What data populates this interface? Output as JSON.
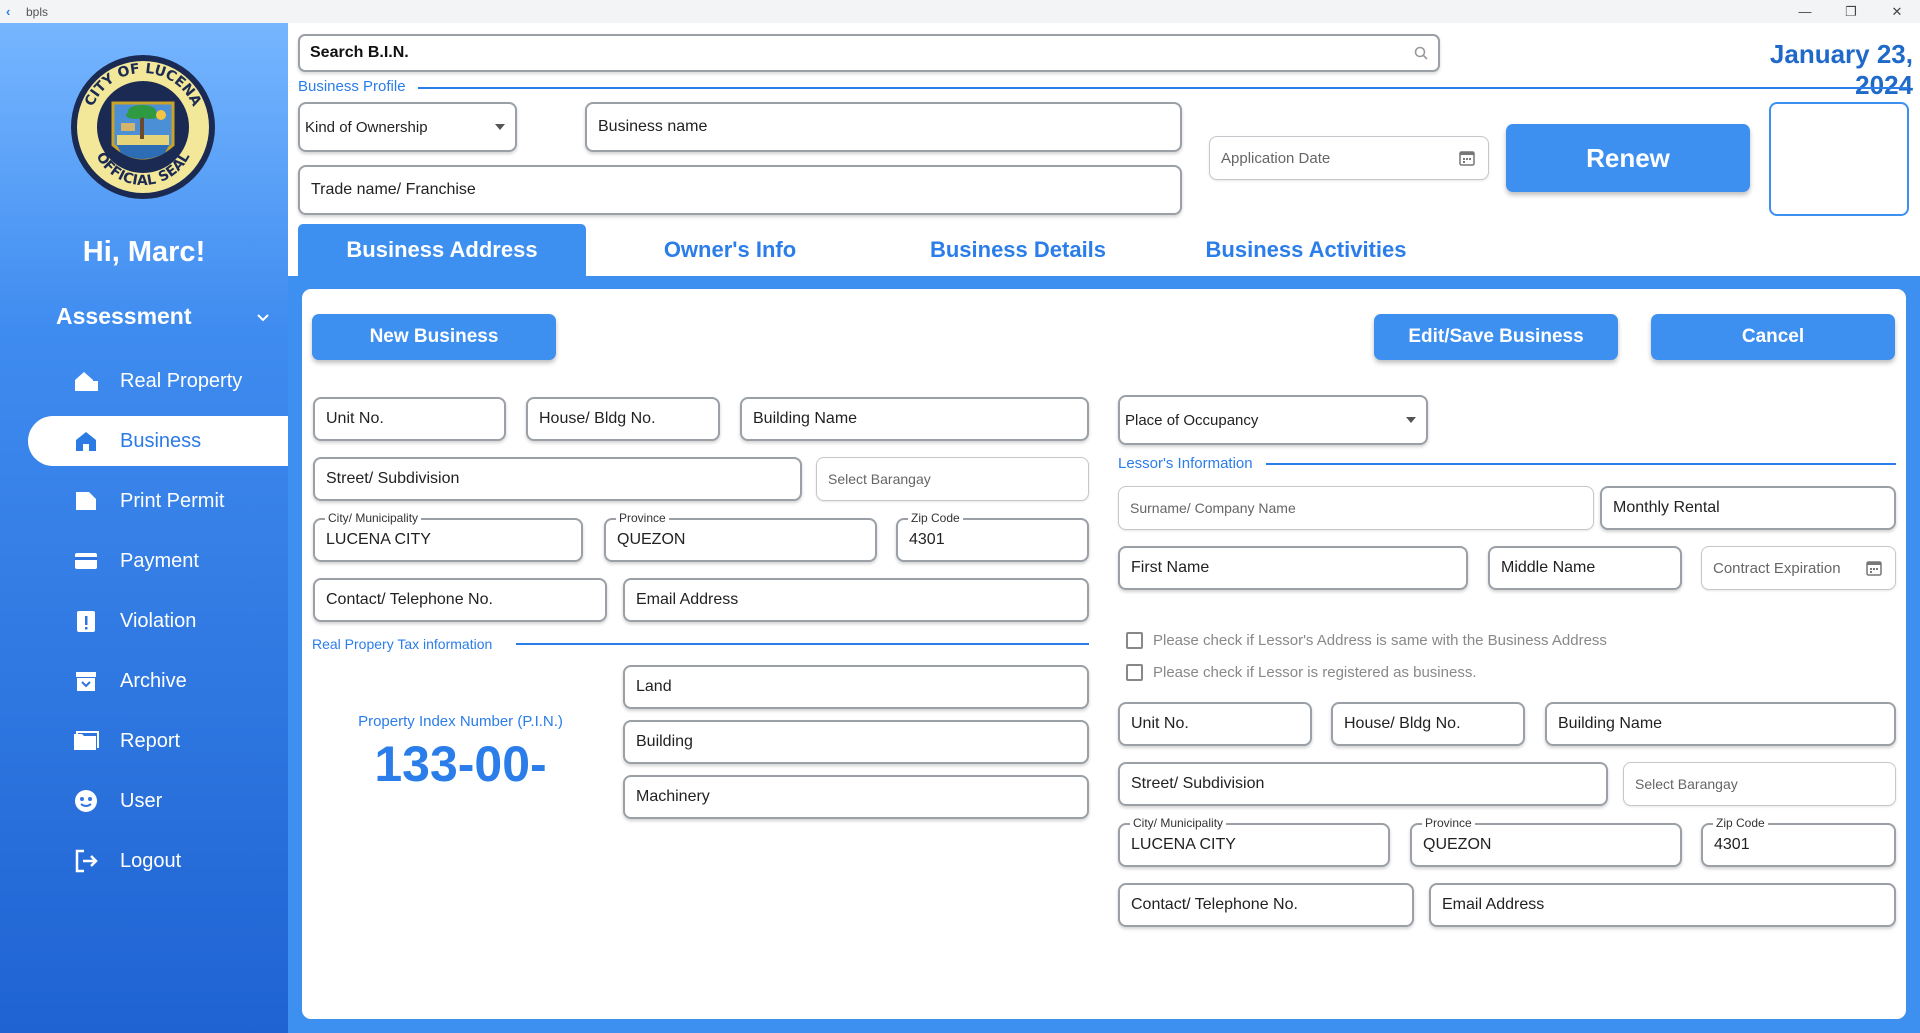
{
  "window": {
    "title": "bpls",
    "minimize": "—",
    "maximize": "❐",
    "close": "✕"
  },
  "sidebar": {
    "greeting": "Hi, Marc!",
    "section": "Assessment",
    "items": [
      {
        "label": "Real Property",
        "icon": "real-property-icon"
      },
      {
        "label": "Business",
        "icon": "home-icon",
        "active": true
      },
      {
        "label": "Print Permit",
        "icon": "print-permit-icon"
      },
      {
        "label": "Payment",
        "icon": "card-icon"
      },
      {
        "label": "Violation",
        "icon": "violation-icon"
      },
      {
        "label": "Archive",
        "icon": "archive-icon"
      },
      {
        "label": "Report",
        "icon": "folder-icon"
      },
      {
        "label": "User",
        "icon": "user-icon"
      },
      {
        "label": "Logout",
        "icon": "logout-icon"
      }
    ],
    "seal_text": [
      "CITY OF LUCENA",
      "OFFICIAL SEAL"
    ]
  },
  "header": {
    "search_label": "Search B.I.N.",
    "date": "January 23, 2024",
    "section_label": "Business Profile",
    "kind_of_ownership": "Kind of Ownership",
    "business_name": "Business name",
    "trade_name": "Trade name/ Franchise",
    "application_date": "Application Date",
    "renew_label": "Renew"
  },
  "tabs": [
    "Business Address",
    "Owner's Info",
    "Business Details",
    "Business Activities"
  ],
  "actions": {
    "new_business": "New Business",
    "edit_save": "Edit/Save Business",
    "cancel": "Cancel"
  },
  "business_address": {
    "unit_no": "Unit No.",
    "house_bldg": "House/ Bldg No.",
    "building_name": "Building Name",
    "street": "Street/ Subdivision",
    "barangay": "Select Barangay",
    "city_label": "City/ Municipality",
    "city": "LUCENA CITY",
    "province_label": "Province",
    "province": "QUEZON",
    "zip_label": "Zip Code",
    "zip": "4301",
    "contact": "Contact/ Telephone No.",
    "email": "Email Address"
  },
  "rpt": {
    "section_label": "Real Propery Tax information",
    "pin_label": "Property Index Number (P.I.N.)",
    "pin_value": "133-00-",
    "land": "Land",
    "building": "Building",
    "machinery": "Machinery"
  },
  "lessor": {
    "place_of_occupancy": "Place of Occupancy",
    "section_label": "Lessor's Information",
    "surname": "Surname/ Company Name",
    "monthly_rental": "Monthly Rental",
    "first_name": "First Name",
    "middle_name": "Middle Name",
    "contract_expiration": "Contract Expiration",
    "check_same_address": "Please check if Lessor's Address is same with the Business Address",
    "check_registered": "Please check if Lessor is registered as business.",
    "unit_no": "Unit No.",
    "house_bldg": "House/ Bldg No.",
    "building_name": "Building Name",
    "street": "Street/ Subdivision",
    "barangay": "Select Barangay",
    "city_label": "City/ Municipality",
    "city": "LUCENA CITY",
    "province_label": "Province",
    "province": "QUEZON",
    "zip_label": "Zip Code",
    "zip": "4301",
    "contact": "Contact/ Telephone No.",
    "email": "Email Address"
  },
  "colors": {
    "accent": "#3d8ff0",
    "accent_text": "#2b7de9",
    "date": "#1f69c9"
  }
}
